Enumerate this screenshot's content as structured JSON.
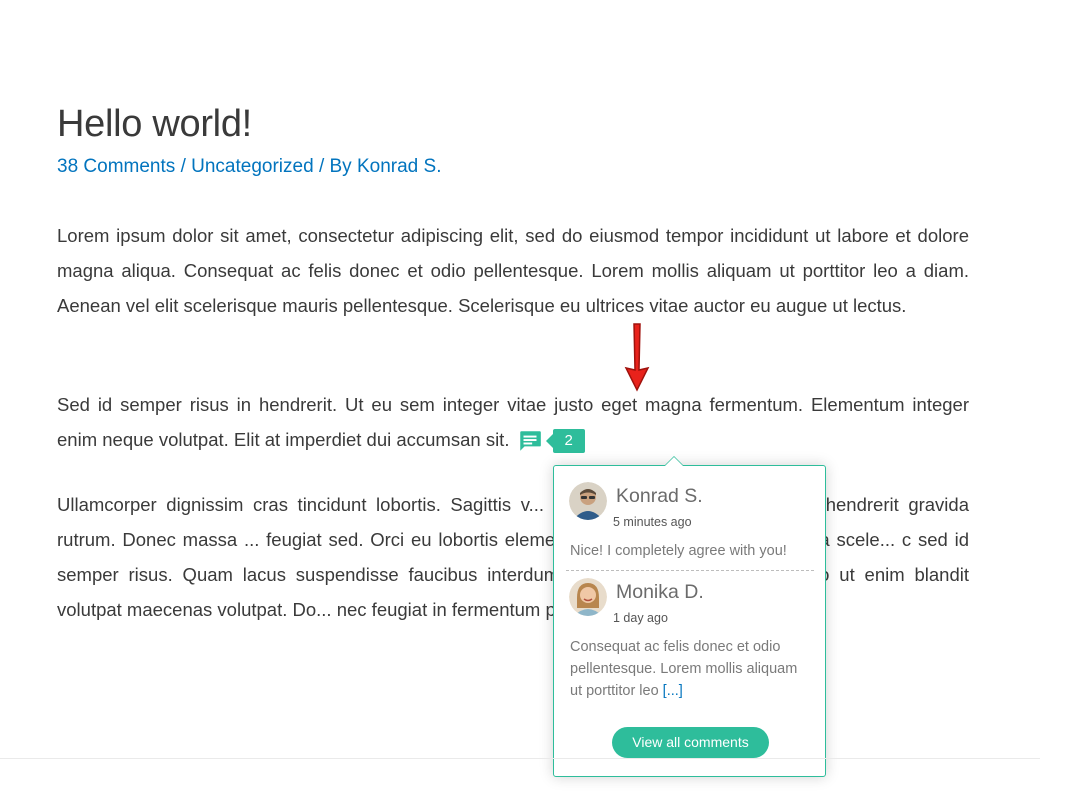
{
  "post": {
    "title": "Hello world!",
    "meta": {
      "comments_link": "38 Comments",
      "separator": "/",
      "category": "Uncategorized",
      "by_prefix": "By",
      "author": "Konrad S."
    },
    "paragraphs": [
      "Lorem ipsum dolor sit amet, consectetur adipiscing elit, sed do eiusmod tempor incididunt ut labore et dolore magna aliqua. Consequat ac felis donec et odio pellentesque. Lorem mollis aliquam ut porttitor leo a diam. Aenean vel elit scelerisque mauris pellentesque. Scelerisque eu ultrices vitae auctor eu augue ut lectus.",
      "Sed id semper risus in hendrerit. Ut eu sem integer vitae justo eget magna fermentum. Elementum integer enim neque volutpat. Elit at imperdiet dui accumsan sit.",
      "Ullamcorper dignissim cras tincidunt lobortis. Sagittis v... nulla porttitor. Semper risus in hendrerit gravida rutrum. Donec massa ... feugiat sed. Orci eu lobortis elementum nibh. Ultrices sagittis orci a scele... c sed id semper risus. Quam lacus suspendisse faucibus interdum. Amet... d. Sed vulputate odio ut enim blandit volutpat maecenas volutpat. Do... nec feugiat in fermentum posuere urna."
    ]
  },
  "inline_comments": {
    "count": "2",
    "icon": "comment-bubble-icon",
    "accent_color": "#2ebd9b",
    "comments": [
      {
        "author": "Konrad S.",
        "time": "5 minutes ago",
        "text": "Nice! I completely agree with you!"
      },
      {
        "author": "Monika D.",
        "time": "1 day ago",
        "text": "Consequat ac felis donec et odio pellentesque. Lorem mollis aliquam ut porttitor leo",
        "more": "[...]"
      }
    ],
    "view_all_label": "View all comments"
  },
  "annotation": {
    "icon": "red-arrow-down-icon",
    "color": "#e8221b"
  }
}
